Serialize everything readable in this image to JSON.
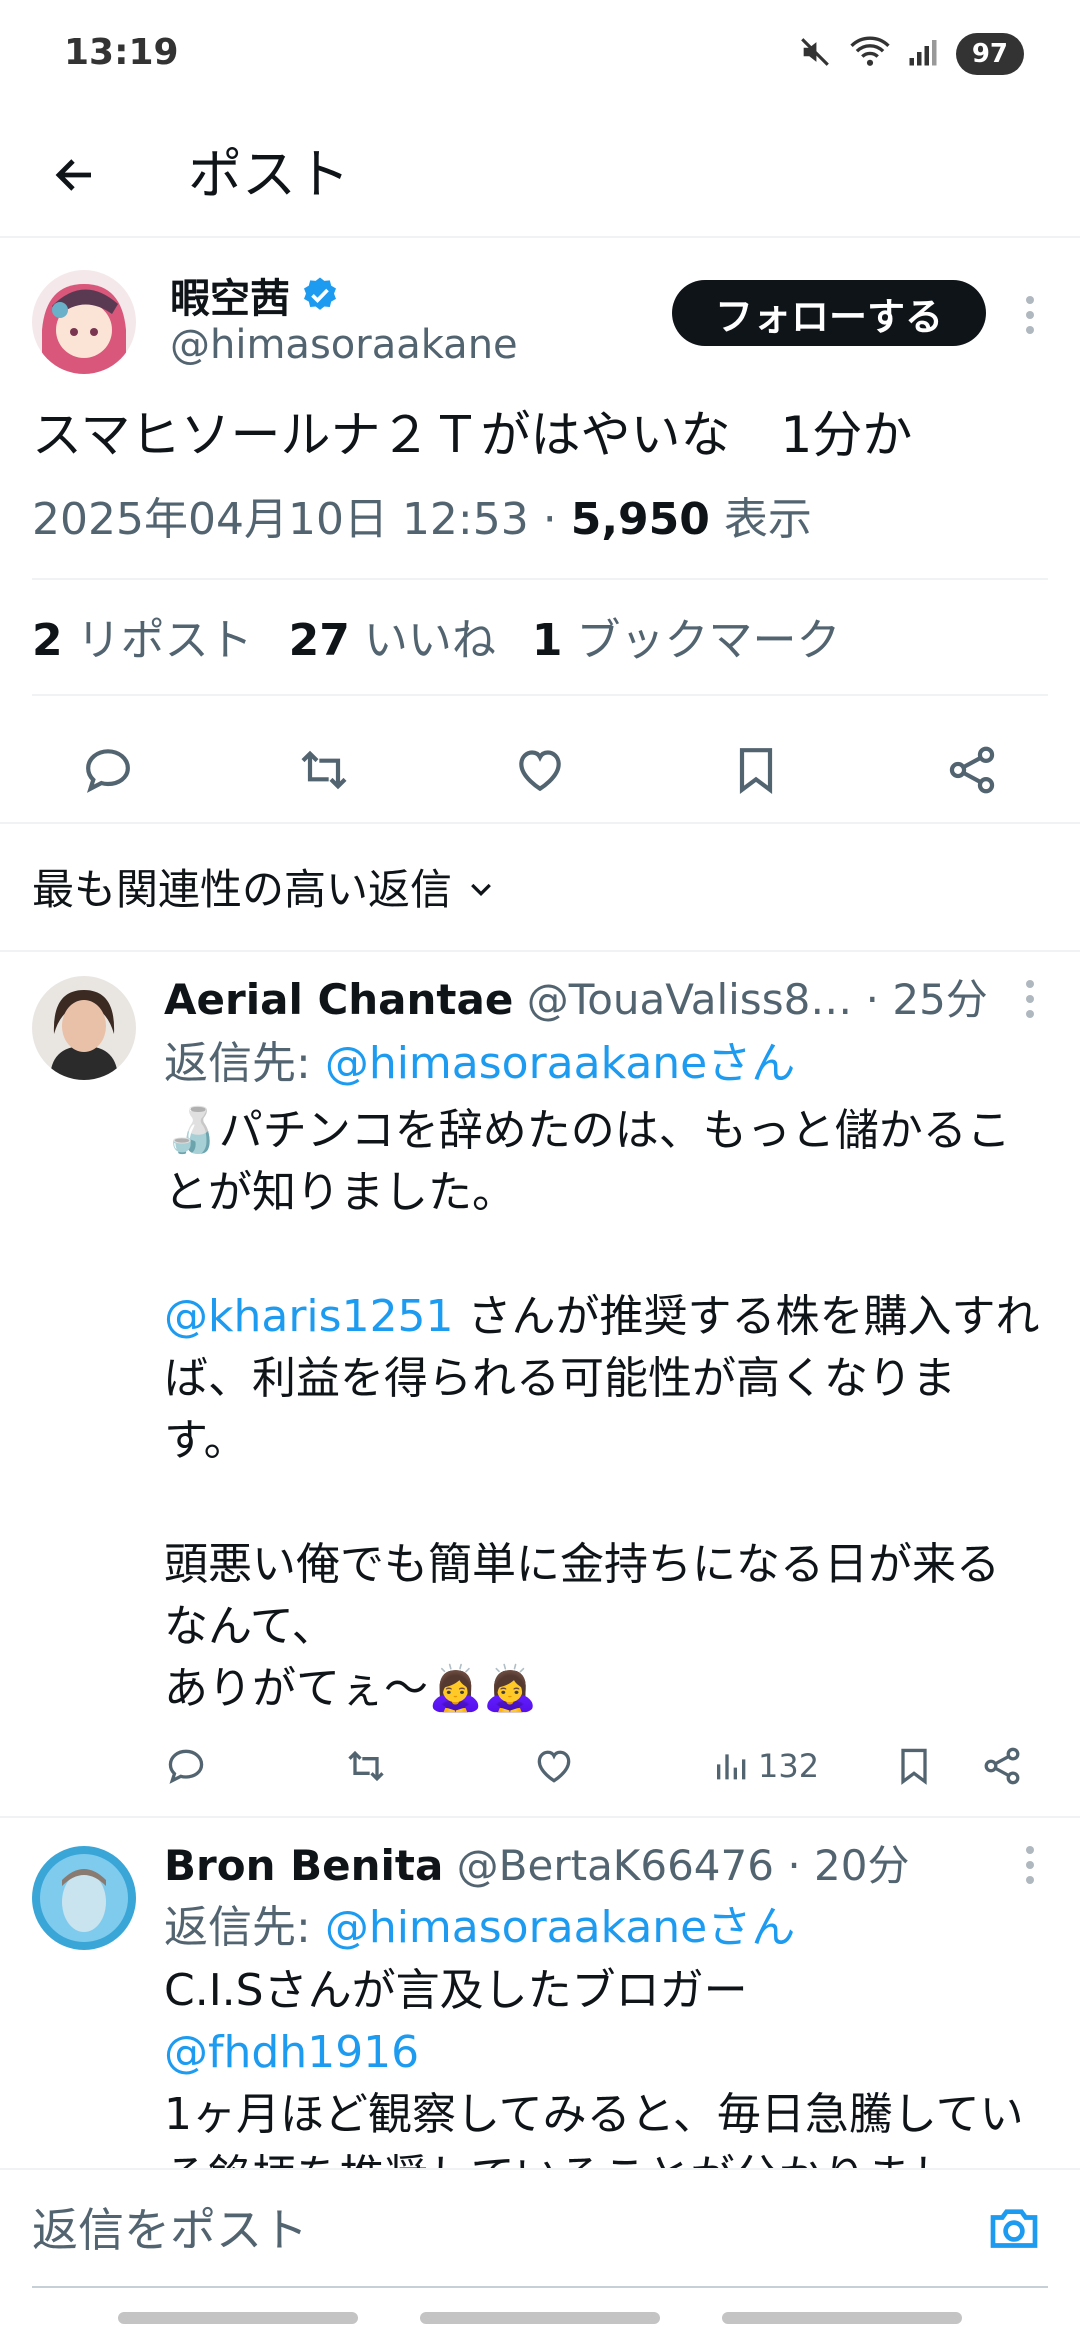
{
  "status_bar": {
    "time": "13:19",
    "battery": "97"
  },
  "header": {
    "title": "ポスト"
  },
  "post": {
    "author_name": "暇空茜",
    "author_handle": "@himasoraakane",
    "follow_label": "フォローする",
    "text": "スマヒソールナ２Ｔがはやいな　1分か",
    "timestamp": "2025年04月10日 12:53 · ",
    "views_count": "5,950",
    "views_label": " 表示",
    "stats": {
      "reposts_count": "2",
      "reposts_label": " リポスト",
      "likes_count": "27",
      "likes_label": " いいね",
      "bookmarks_count": "1",
      "bookmarks_label": " ブックマーク"
    }
  },
  "sort": {
    "label": "最も関連性の高い返信"
  },
  "replies": [
    {
      "name": "Aerial Chantae",
      "handle": " @TouaValiss8…",
      "time": " · 25分",
      "reply_to_prefix": "返信先: ",
      "reply_to": "@himasoraakaneさん",
      "line1": "🍶パチンコを辞めたのは、もっと儲かるこ",
      "line2": "とが知りました。",
      "mention": "@kharis1251",
      "line3": " さんが推奨する株を購入すれ",
      "line4": "ば、利益を得られる可能性が高くなりま",
      "line5": "す。",
      "line6": "頭悪い俺でも簡単に金持ちになる日が来る",
      "line7": "なんて、",
      "line8": "ありがてぇ～🙇‍♀️🙇‍♀️",
      "views": "132"
    },
    {
      "name": "Bron Benita",
      "handle": " @BertaK66476",
      "time": " · 20分",
      "reply_to_prefix": "返信先: ",
      "reply_to": "@himasoraakaneさん",
      "line1": "C.I.Sさんが言及したブロガー",
      "mention": "@fhdh1916",
      "line2": "1ヶ月ほど観察してみると、毎日急騰してい",
      "line3": "る銘柄を推奨していることが分かりまし"
    }
  ],
  "composer": {
    "placeholder": "返信をポスト"
  },
  "colors": {
    "accent": "#1d9bf0",
    "text": "#0f1419",
    "muted": "#536471",
    "verified": "#1d9bf0"
  }
}
